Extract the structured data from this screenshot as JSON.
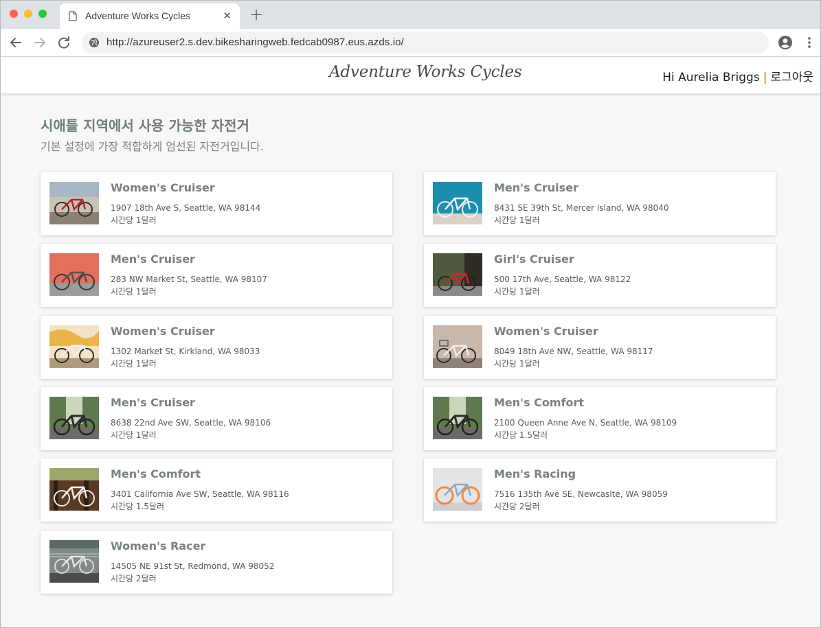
{
  "browser": {
    "tab_title": "Adventure Works Cycles",
    "tab_close": "✕",
    "new_tab": "+",
    "url": "http://azureuser2.s.dev.bikesharingweb.fedcab0987.eus.azds.io/"
  },
  "header": {
    "logo_text": "Adventure Works Cycles",
    "greeting": "Hi Aurelia Briggs",
    "separator": "|",
    "logout": "로그아웃"
  },
  "main": {
    "heading": "시애틀 지역에서 사용 가능한 자전거",
    "subheading": "기본 설정에 가장 적합하게 엄선된 자전거입니다."
  },
  "bikes": [
    {
      "name": "Women's Cruiser",
      "address": "1907 18th Ave S, Seattle, WA 98144",
      "price": "시간당 1달러"
    },
    {
      "name": "Men's Cruiser",
      "address": "8431 SE 39th St, Mercer Island, WA 98040",
      "price": "시간당 1달러"
    },
    {
      "name": "Men's Cruiser",
      "address": "283 NW Market St, Seattle, WA 98107",
      "price": "시간당 1달러"
    },
    {
      "name": "Girl's Cruiser",
      "address": "500 17th Ave, Seattle, WA 98122",
      "price": "시간당 1달러"
    },
    {
      "name": "Women's Cruiser",
      "address": "1302 Market St, Kirkland, WA 98033",
      "price": "시간당 1달러"
    },
    {
      "name": "Women's Cruiser",
      "address": "8049 18th Ave NW, Seattle, WA 98117",
      "price": "시간당 1달러"
    },
    {
      "name": "Men's Cruiser",
      "address": "8638 22nd Ave SW, Seattle, WA 98106",
      "price": "시간당 1달러"
    },
    {
      "name": "Men's Comfort",
      "address": "2100 Queen Anne Ave N, Seattle, WA 98109",
      "price": "시간당 1.5달러"
    },
    {
      "name": "Men's Comfort",
      "address": "3401 California Ave SW, Seattle, WA 98116",
      "price": "시간당 1.5달러"
    },
    {
      "name": "Men's Racing",
      "address": "7516 135th Ave SE, Newcaslte, WA 98059",
      "price": "시간당 2달러"
    },
    {
      "name": "Women's Racer",
      "address": "14505 NE 91st St, Redmond, WA 98052",
      "price": "시간당 2달러"
    }
  ],
  "colors": {
    "accent_separator": "#d36b00",
    "heading": "#6d7c7a"
  }
}
